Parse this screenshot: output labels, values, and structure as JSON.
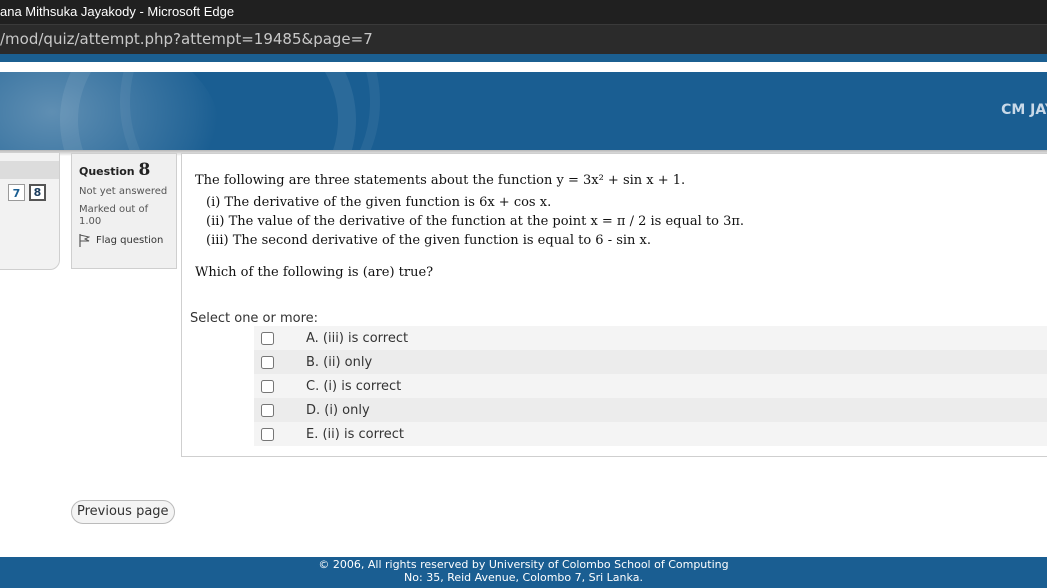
{
  "window": {
    "title": "ana Mithsuka Jayakody - Microsoft Edge"
  },
  "address_bar": {
    "url": "/mod/quiz/attempt.php?attempt=19485&page=7"
  },
  "header": {
    "user_name": "CM JAY"
  },
  "colors": {
    "brand_blue": "#1a5e92",
    "chrome_dark": "#202020"
  },
  "nav": {
    "buttons": [
      "7",
      "8"
    ],
    "current": "8"
  },
  "question_info": {
    "label": "Question",
    "number": "8",
    "state": "Not yet answered",
    "grade": "Marked out of 1.00",
    "flag_label": "Flag question"
  },
  "question": {
    "intro": "The following are three statements about the function y = 3x² + sin x + 1.",
    "statement_1": "(i) The derivative of the given function is 6x + cos x.",
    "statement_2": "(ii) The value of the derivative of the function at the point x = π / 2 is equal to 3π.",
    "statement_3": "(iii) The second derivative of the given function is equal to 6 - sin x.",
    "ask": "Which of the following is (are) true?",
    "prompt": "Select one or more:",
    "options": [
      {
        "label": "A. (iii) is correct",
        "checked": false
      },
      {
        "label": "B. (ii) only",
        "checked": false
      },
      {
        "label": "C. (i) is correct",
        "checked": false
      },
      {
        "label": "D. (i) only",
        "checked": false
      },
      {
        "label": "E. (ii) is correct",
        "checked": false
      }
    ]
  },
  "navigation": {
    "previous_label": "Previous page"
  },
  "footer": {
    "line1": "© 2006, All rights reserved by University of Colombo School of Computing",
    "line2": "No: 35, Reid Avenue, Colombo 7, Sri Lanka."
  }
}
